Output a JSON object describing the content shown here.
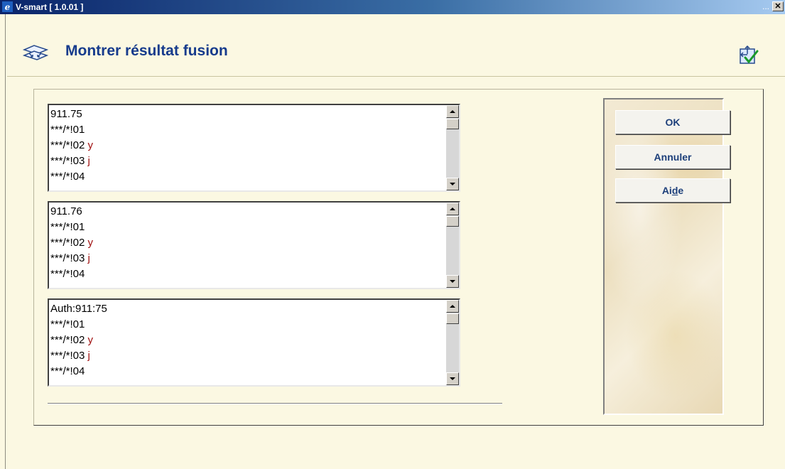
{
  "window": {
    "title": "V-smart [ 1.0.01 ]",
    "more": "..."
  },
  "header": {
    "title": "Montrer résultat fusion"
  },
  "lists": [
    {
      "lines": [
        {
          "text": "911.75",
          "suffix": ""
        },
        {
          "text": "***/*!01",
          "suffix": ""
        },
        {
          "text": "***/*!02 ",
          "suffix": "y"
        },
        {
          "text": "***/*!03 ",
          "suffix": "j"
        },
        {
          "text": "***/*!04",
          "suffix": ""
        }
      ]
    },
    {
      "lines": [
        {
          "text": "911.76",
          "suffix": ""
        },
        {
          "text": "***/*!01",
          "suffix": ""
        },
        {
          "text": "***/*!02 ",
          "suffix": "y"
        },
        {
          "text": "***/*!03 ",
          "suffix": "j"
        },
        {
          "text": "***/*!04",
          "suffix": ""
        }
      ]
    },
    {
      "lines": [
        {
          "text": "Auth:911:75",
          "suffix": ""
        },
        {
          "text": "***/*!01",
          "suffix": ""
        },
        {
          "text": "***/*!02 ",
          "suffix": "y"
        },
        {
          "text": "***/*!03 ",
          "suffix": "j"
        },
        {
          "text": "***/*!04",
          "suffix": ""
        }
      ]
    }
  ],
  "buttons": {
    "ok": "OK",
    "cancel": "Annuler",
    "help_pre": "Ai",
    "help_ul": "d",
    "help_post": "e"
  },
  "colors": {
    "background": "#fbf8e2",
    "title_text": "#163b8c",
    "accent_red": "#a01010"
  }
}
